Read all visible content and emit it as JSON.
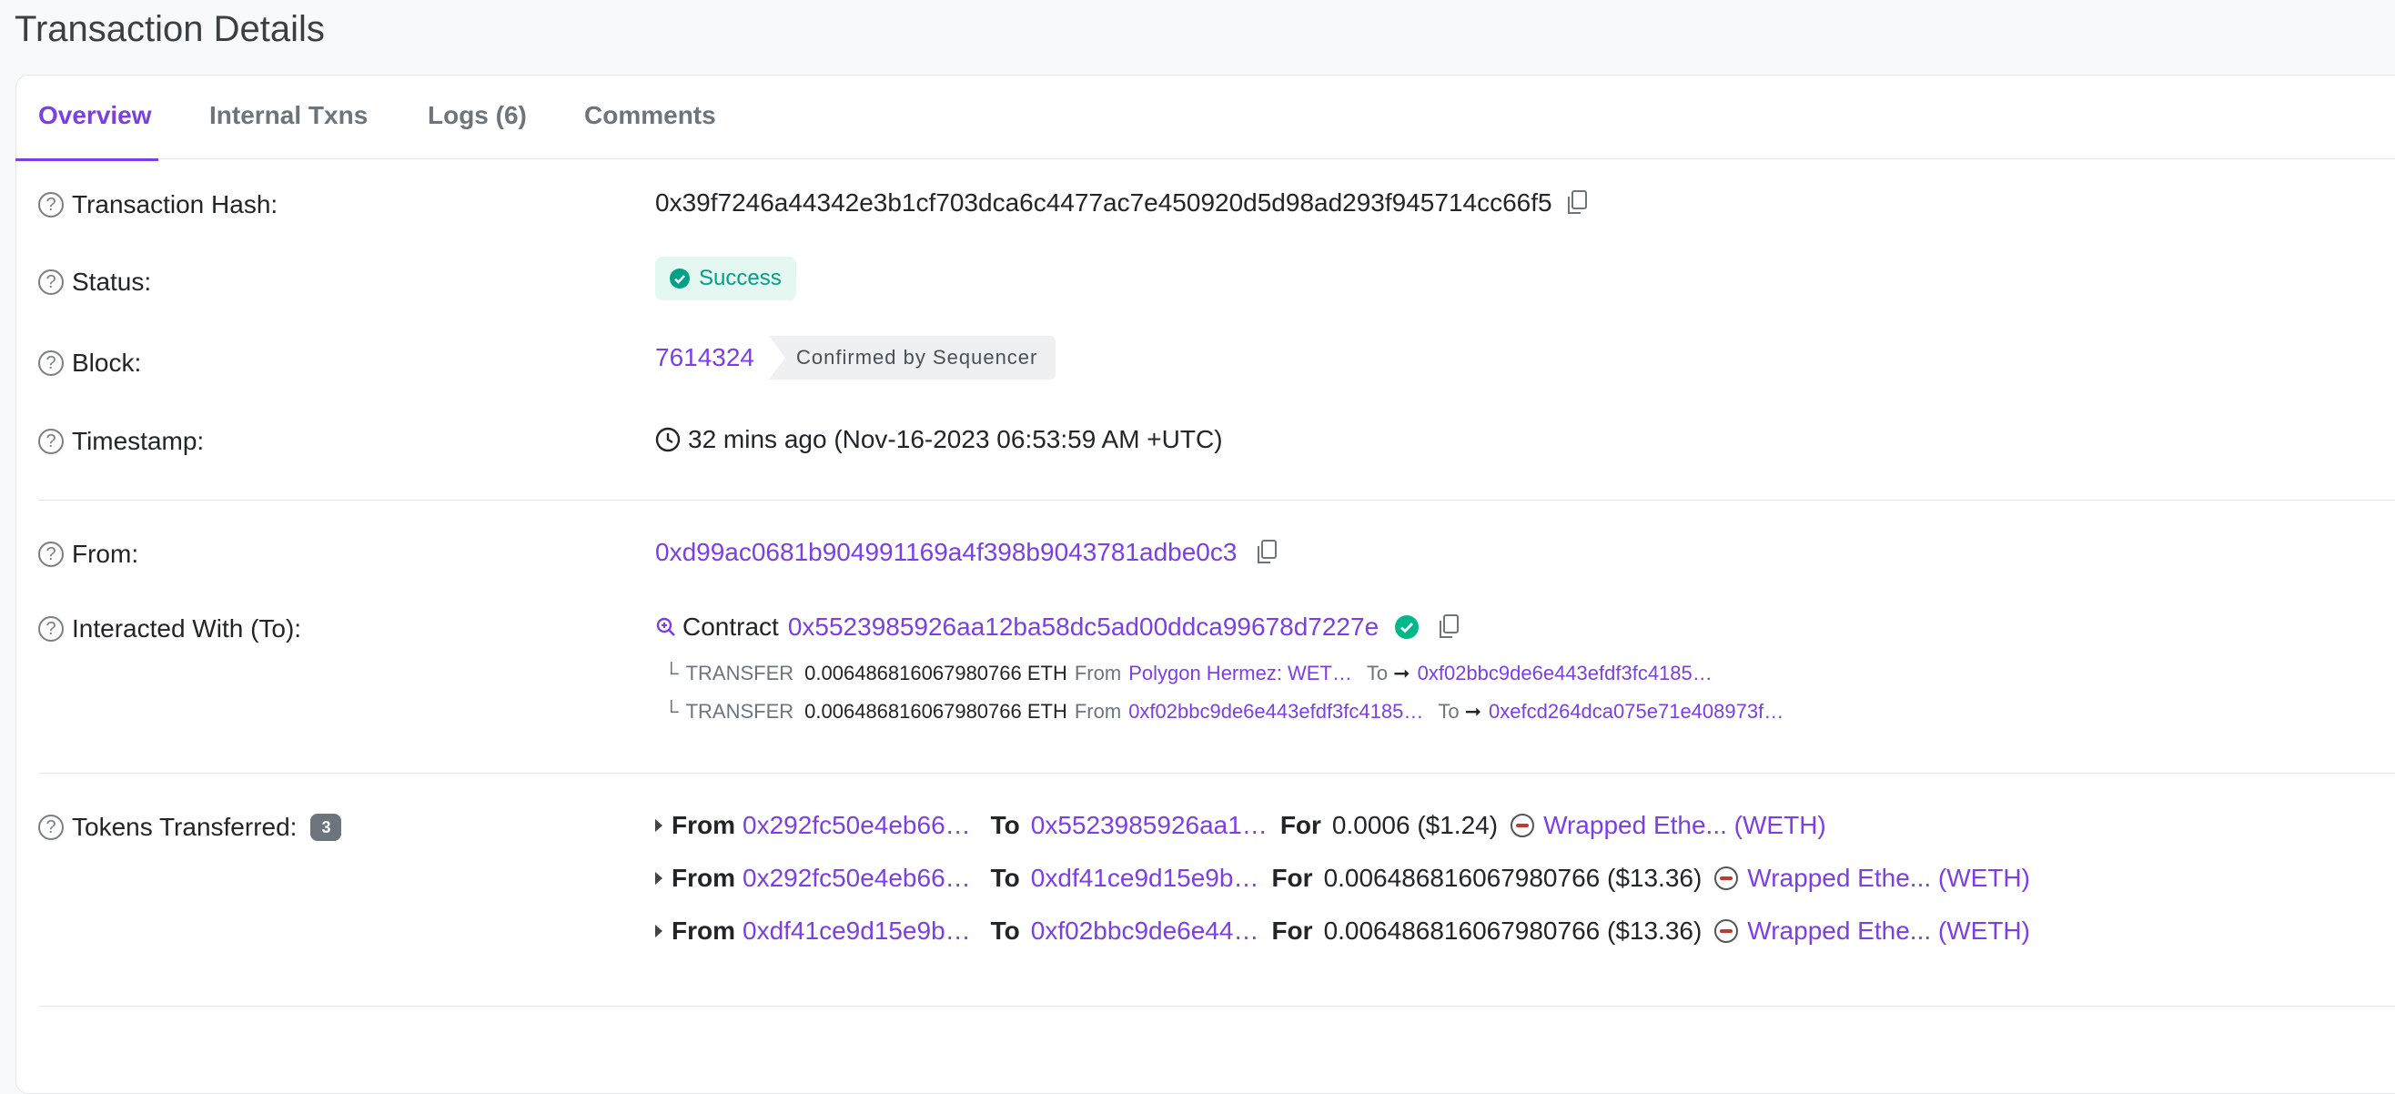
{
  "page": {
    "title": "Transaction Details"
  },
  "tabs": [
    {
      "label": "Overview",
      "active": true
    },
    {
      "label": "Internal Txns"
    },
    {
      "label": "Logs (6)"
    },
    {
      "label": "Comments"
    }
  ],
  "fields": {
    "tx_hash": {
      "label": "Transaction Hash:",
      "value": "0x39f7246a44342e3b1cf703dca6c4477ac7e450920d5d98ad293f945714cc66f5"
    },
    "status": {
      "label": "Status:",
      "value": "Success"
    },
    "block": {
      "label": "Block:",
      "value": "7614324",
      "confirmation": "Confirmed by Sequencer"
    },
    "timestamp": {
      "label": "Timestamp:",
      "value": "32 mins ago (Nov-16-2023 06:53:59 AM +UTC)"
    },
    "from": {
      "label": "From:",
      "value": "0xd99ac0681b904991169a4f398b9043781adbe0c3"
    },
    "interacted": {
      "label": "Interacted With (To):",
      "prefix": "Contract",
      "address": "0x5523985926aa12ba58dc5ad00ddca99678d7227e",
      "transfers": [
        {
          "tree": "└",
          "type": "TRANSFER",
          "amount": "0.006486816067980766 ETH",
          "from_label": "From",
          "from": "Polygon Hermez: WET…",
          "to_label": "To",
          "arrow": "➞",
          "to": "0xf02bbc9de6e443efdf3fc4185…"
        },
        {
          "tree": "└",
          "type": "TRANSFER",
          "amount": "0.006486816067980766 ETH",
          "from_label": "From",
          "from": "0xf02bbc9de6e443efdf3fc4185…",
          "to_label": "To",
          "arrow": "➞",
          "to": "0xefcd264dca075e71e408973f…"
        }
      ]
    },
    "tokens": {
      "label": "Tokens Transferred:",
      "count": "3",
      "from_label": "From",
      "to_label": "To",
      "for_label": "For",
      "rows": [
        {
          "from": "0x292fc50e4eb66…",
          "to": "0x5523985926aa1…",
          "amount": "0.0006 ($1.24)",
          "token": "Wrapped Ethe... (WETH)"
        },
        {
          "from": "0x292fc50e4eb66…",
          "to": "0xdf41ce9d15e9b…",
          "amount": "0.006486816067980766 ($13.36)",
          "token": "Wrapped Ethe... (WETH)"
        },
        {
          "from": "0xdf41ce9d15e9b…",
          "to": "0xf02bbc9de6e44…",
          "amount": "0.006486816067980766 ($13.36)",
          "token": "Wrapped Ethe... (WETH)"
        }
      ]
    }
  },
  "icons": {
    "help": "question-circle-icon",
    "copy": "copy-icon",
    "success": "check-circle-icon",
    "clock": "clock-icon",
    "contract": "magnifier-contract-icon",
    "verified": "verified-check-icon",
    "token": "weth-token-icon",
    "expand": "caret-right-icon"
  },
  "colors": {
    "accent": "#7b3fe4",
    "success": "#00a186",
    "success_bg": "#e4f7f1",
    "text": "#212529",
    "muted": "#6c757d"
  }
}
